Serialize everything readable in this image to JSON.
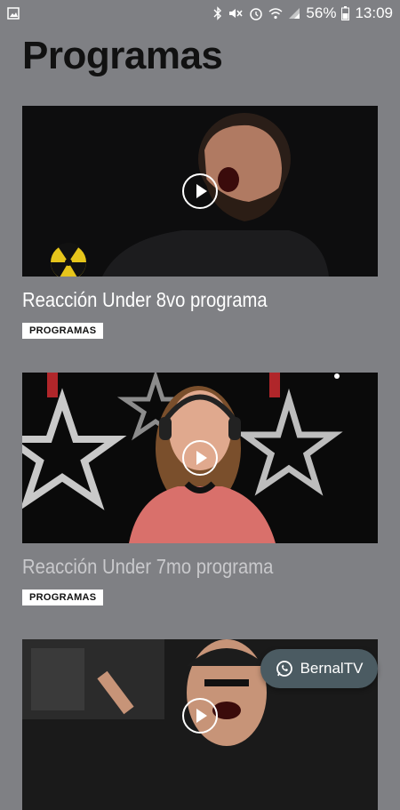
{
  "status_bar": {
    "battery_percent": "56%",
    "time": "13:09",
    "icons": [
      "image-notification-icon",
      "bluetooth-icon",
      "mute-icon",
      "alarm-icon",
      "wifi-icon",
      "signal-icon",
      "battery-icon"
    ]
  },
  "page": {
    "title": "Programas"
  },
  "videos": [
    {
      "title": "Reacción Under 8vo programa",
      "category": "PROGRAMAS",
      "title_color": "#ffffff"
    },
    {
      "title": "Reacción Under 7mo programa",
      "category": "PROGRAMAS",
      "title_color": "#c9c9cc"
    },
    {
      "title": "",
      "category": ""
    }
  ],
  "whatsapp_button": {
    "label": "BernalTV",
    "icon": "whatsapp-icon"
  }
}
